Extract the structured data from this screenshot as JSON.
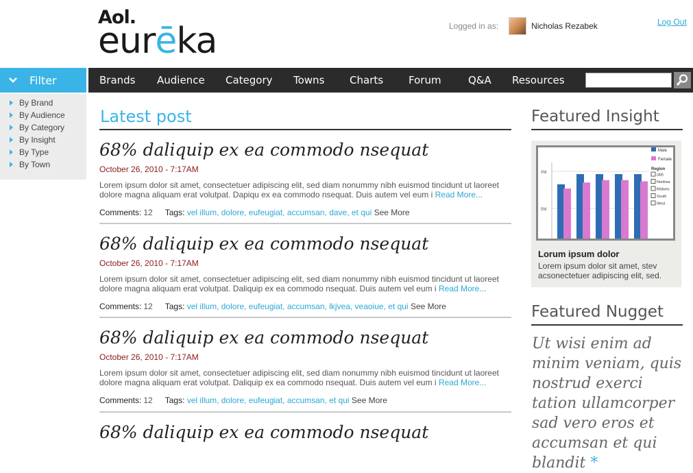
{
  "header": {
    "logo_top": "Aol.",
    "logo_main_pre": "eur",
    "logo_main_accent": "ē",
    "logo_main_post": "ka",
    "logged_in_label": "Logged in as:",
    "user_name": "Nicholas Rezabek",
    "logout_label": "Log Out"
  },
  "filter": {
    "title": "Filter",
    "items": [
      "By Brand",
      "By Audience",
      "By Category",
      "By Insight",
      "By Type",
      "By Town"
    ]
  },
  "nav": {
    "items": [
      "Brands",
      "Audience",
      "Category",
      "Towns",
      "Charts",
      "Forum",
      "Q&A",
      "Resources"
    ],
    "search_value": ""
  },
  "main": {
    "section_title": "Latest post",
    "posts": [
      {
        "title": "68% daliquip ex ea commodo nsequat",
        "date": "October 26, 2010 - 7:17AM",
        "body": "Lorem ipsum dolor sit amet, consectetuer adipiscing elit, sed diam nonummy nibh euismod tincidunt ut laoreet dolore magna aliquam erat volutpat. Dapiqu ex ea commodo nsequat. Duis autem vel eum i",
        "read_more": "Read More...",
        "comments_label": "Comments:",
        "comments": "12",
        "tags_label": "Tags:",
        "tags": "vel illum, dolore, eufeugiat, accumsan, dave, et qui",
        "see_more": "See More"
      },
      {
        "title": "68% daliquip ex ea commodo nsequat",
        "date": "October 26, 2010 - 7:17AM",
        "body": "Lorem ipsum dolor sit amet, consectetuer adipiscing elit, sed diam nonummy nibh euismod tincidunt ut laoreet dolore magna aliquam erat volutpat. Daliquip ex ea commodo nsequat. Duis autem vel eum i",
        "read_more": "Read More...",
        "comments_label": "Comments:",
        "comments": "12",
        "tags_label": "Tags:",
        "tags": "vel illum, dolore, eufeugiat, accumsan, lkjvea, veaoiue, et qui",
        "see_more": "See More"
      },
      {
        "title": "68% daliquip ex ea commodo nsequat",
        "date": "October 26, 2010 - 7:17AM",
        "body": "Lorem ipsum dolor sit amet, consectetuer adipiscing elit, sed diam nonummy nibh euismod tincidunt ut laoreet dolore magna aliquam erat volutpat. Daliquip ex ea commodo nsequat. Duis autem vel eum i",
        "read_more": "Read More...",
        "comments_label": "Comments:",
        "comments": "12",
        "tags_label": "Tags:",
        "tags": "vel illum, dolore, eufeugiat, accumsan, et qui",
        "see_more": "See More"
      },
      {
        "title": "68% daliquip ex ea commodo nsequat"
      }
    ]
  },
  "right": {
    "insight_title": "Featured Insight",
    "insight_heading": "Lorum ipsum dolor",
    "insight_text": "Lorem ipsum dolor sit amet, stev acsonectetuer adipiscing elit, sed.",
    "nugget_title": "Featured Nugget",
    "nugget_text": "Ut wisi enim ad minim veniam, quis nostrud exerci tation ullamcorper sad vero eros et accumsan et qui blandit",
    "nugget_mark": "*"
  },
  "chart_data": {
    "type": "bar",
    "categories": [
      "All",
      "Northeast",
      "Midwest",
      "South",
      "West"
    ],
    "series": [
      {
        "name": "Male",
        "values": [
          0.95,
          1.12,
          1.12,
          1.12,
          1.12
        ]
      },
      {
        "name": "Female",
        "values": [
          0.88,
          0.98,
          1.02,
          1.02,
          1.0
        ]
      }
    ],
    "legend": [
      "Male",
      "Female"
    ],
    "legend_group_title": "Region",
    "region_items": [
      "(All)",
      "Northea",
      "Midwes",
      "South",
      "West"
    ],
    "tick_labels": [
      "0M",
      "5M"
    ],
    "colors": {
      "Male": "#2e6db4",
      "Female": "#d77ad0"
    }
  },
  "colors": {
    "accent": "#3ab4e6",
    "nav_bg": "#2b2b2b",
    "date": "#8b1a1a"
  }
}
